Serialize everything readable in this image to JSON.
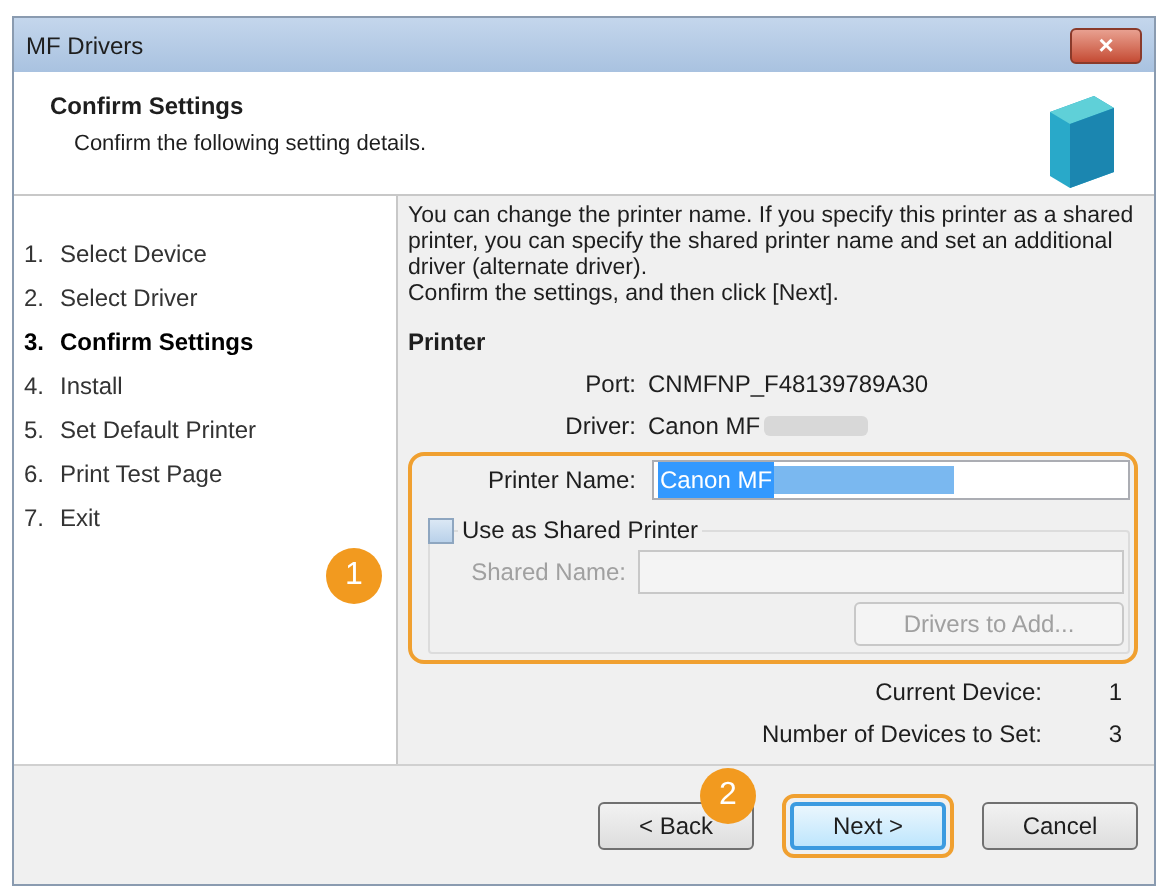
{
  "window": {
    "title": "MF Drivers",
    "close_label": "×"
  },
  "header": {
    "title": "Confirm Settings",
    "subtitle": "Confirm the following setting details."
  },
  "steps": [
    {
      "number": "1.",
      "label": "Select Device",
      "selected": false
    },
    {
      "number": "2.",
      "label": "Select Driver",
      "selected": false
    },
    {
      "number": "3.",
      "label": "Confirm Settings",
      "selected": true
    },
    {
      "number": "4.",
      "label": "Install",
      "selected": false
    },
    {
      "number": "5.",
      "label": "Set Default Printer",
      "selected": false
    },
    {
      "number": "6.",
      "label": "Print Test Page",
      "selected": false
    },
    {
      "number": "7.",
      "label": "Exit",
      "selected": false
    }
  ],
  "instructions": [
    "You can change the printer name. If you specify this printer as a shared printer, you can specify the shared printer name and set an additional driver (alternate driver).",
    "Confirm the settings, and then click [Next]."
  ],
  "printer": {
    "heading": "Printer",
    "port_label": "Port:",
    "port": "CNMFNP_F48139789A30",
    "driver_label": "Driver:",
    "driver": "Canon MF",
    "printer_name_label": "Printer Name:",
    "printer_name": "Canon MF",
    "share_label": "Use as Shared Printer",
    "share_checked": false,
    "shared_name_label": "Shared Name:",
    "shared_disabled": true,
    "drivers_button": "Drivers to Add..."
  },
  "counts": [
    {
      "label": "Current Device:",
      "value": "1"
    },
    {
      "label": "Number of Devices to Set:",
      "value": "3"
    }
  ],
  "buttons": [
    {
      "label": "< Back",
      "kind": "normal"
    },
    {
      "label": "Next >",
      "kind": "default"
    },
    {
      "label": "Cancel",
      "kind": "normal"
    }
  ],
  "callouts": [
    "1",
    "2"
  ]
}
